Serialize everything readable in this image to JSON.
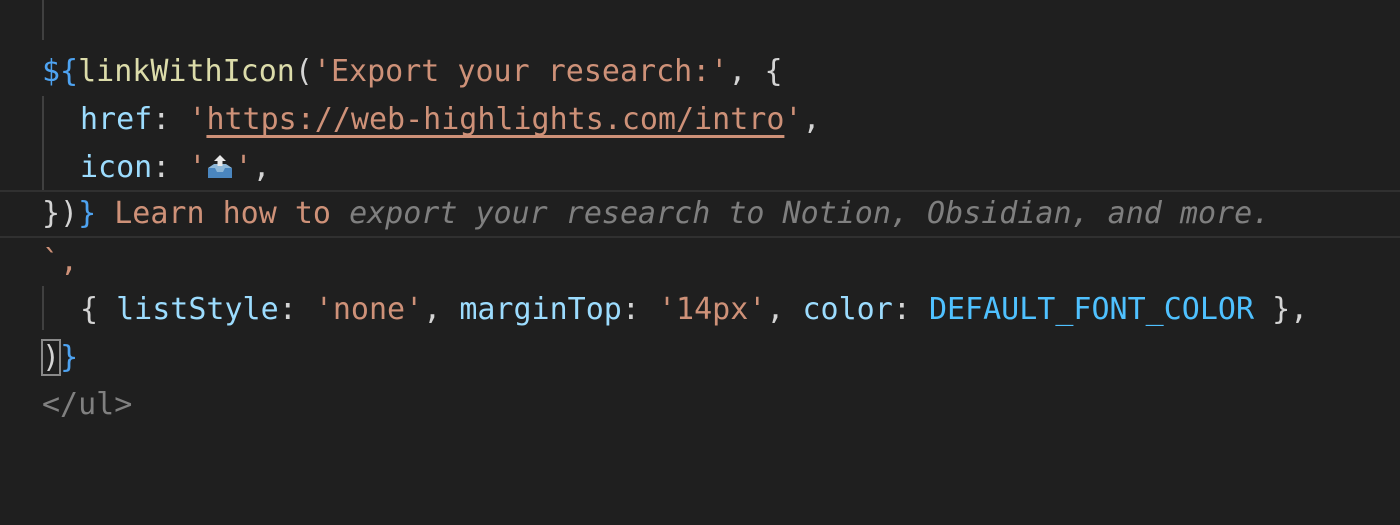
{
  "editor": {
    "lines": {
      "l0": {
        "text": "`"
      },
      "l1": {
        "dollar": "${",
        "fn": "linkWithIcon",
        "open": "(",
        "str": "'Export your research:'",
        "comma": ", ",
        "brace": "{"
      },
      "l2": {
        "prop": "href",
        "colon": ": ",
        "q1": "'",
        "url": "https://web-highlights.com/intro",
        "q2": "'",
        "comma": ","
      },
      "l3": {
        "prop": "icon",
        "colon": ": ",
        "q1": "'",
        "icon": "outbox-tray-icon",
        "q2": "'",
        "comma": ","
      },
      "l4": {
        "close": "})",
        "brace": "}",
        "text": " Learn how to ",
        "ghost": "export your research to Notion, Obsidian, and more."
      },
      "l5": {
        "text": "`,"
      },
      "l6": {
        "open": "{ ",
        "p1": "listStyle",
        "c1": ": ",
        "v1": "'none'",
        "s1": ", ",
        "p2": "marginTop",
        "c2": ": ",
        "v2": "'14px'",
        "s2": ", ",
        "p3": "color",
        "c3": ": ",
        "v3": "DEFAULT_FONT_COLOR",
        "close": " },",
        "pad": ""
      },
      "l7": {
        "paren": ")",
        "brace": "}"
      },
      "l8": {
        "text": "</ul>"
      }
    },
    "colors": {
      "background": "#1f1f1f",
      "string": "#ce9178",
      "function": "#dcdcaa",
      "property": "#9cdcfe",
      "constant": "#4fc1ff",
      "ghost_text": "#7f7f7f"
    }
  }
}
